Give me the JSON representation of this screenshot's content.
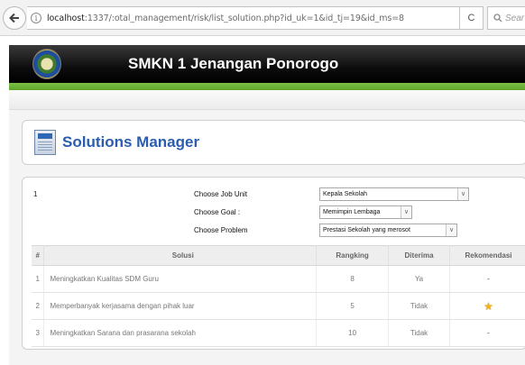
{
  "browser": {
    "url_prefix": "localhost",
    "url_rest": ":1337/:otal_management/risk/list_solution.php?id_uk=1&id_tj=19&id_ms=8",
    "search_placeholder": "Sear",
    "info_glyph": "i",
    "back_glyph": "←",
    "reload_glyph": "C"
  },
  "site": {
    "title": "SMKN 1 Jenangan Ponorogo"
  },
  "manager": {
    "title": "Solutions Manager"
  },
  "filters": {
    "row_number": "1",
    "job_unit": {
      "label": "Choose Job Unit",
      "value": "Kepala Sekolah"
    },
    "goal": {
      "label": "Choose Goal :",
      "value": "Memimpin Lembaga"
    },
    "problem": {
      "label": "Choose Problem",
      "value": "Prestasi Sekolah yang merosot"
    },
    "arrow_glyph": "∨"
  },
  "table": {
    "headers": [
      "#",
      "Solusi",
      "Rangking",
      "Diterima",
      "Rekomendasi"
    ],
    "rows": [
      {
        "num": "1",
        "solusi": "Meningkatkan Kualitas SDM Guru",
        "rangking": "8",
        "diterima": "Ya",
        "rekomendasi": "-"
      },
      {
        "num": "2",
        "solusi": "Memperbanyak kerjasama dengan pihak luar",
        "rangking": "5",
        "diterima": "Tidak",
        "rekomendasi": "star"
      },
      {
        "num": "3",
        "solusi": "Meningkatkan Sarana dan prasarana sekolah",
        "rangking": "10",
        "diterima": "Tidak",
        "rekomendasi": "-"
      }
    ]
  },
  "colors": {
    "header_black": "#000000",
    "accent_green": "#6db33a",
    "title_blue": "#2a5db0",
    "star_gold": "#f0b418"
  }
}
